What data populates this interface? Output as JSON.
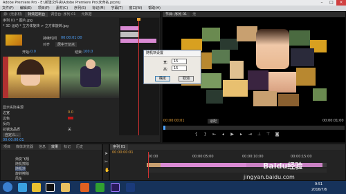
{
  "window": {
    "title": "Adobe Premiere Pro - E:\\新建文件夹\\Adobe Premiere Pro\\未命名.prproj"
  },
  "menu": [
    "文件(F)",
    "编辑(E)",
    "项目(P)",
    "素材(C)",
    "序列(S)",
    "标记(M)",
    "字幕(T)",
    "窗口(W)",
    "帮助(H)"
  ],
  "source_panel": {
    "tabs": [
      "源: (无素材)",
      "特效控制台",
      "调音台: 序列 01",
      "元数据"
    ],
    "clip_path": "序列 01 * 图片.jpg",
    "effect_path": "* 3D 运动 * 立方体旋转 > 立方体旋转.jpg",
    "section1": "持续时间",
    "duration_label": "持续时间",
    "duration_value": "00:00:01:00",
    "align_label": "对齐",
    "align_value": "居中于切点",
    "start_label": "开始:",
    "start_value": "0.0",
    "end_label": "结束:",
    "end_value": "100.0",
    "props": [
      {
        "label": "显示实际来源",
        "value": ""
      },
      {
        "label": "边宽",
        "value": "0.0"
      },
      {
        "label": "边色",
        "value": ""
      },
      {
        "label": "反向",
        "value": ""
      },
      {
        "label": "抗锯齿品质",
        "value": "关"
      },
      {
        "label": "自定义...",
        "value": ""
      }
    ],
    "timecode": "00:00:00:01"
  },
  "program_panel": {
    "tabs": [
      "节目: 序列 01",
      "无"
    ],
    "timecode": "00:00:00:01",
    "fit": "适配",
    "duration": "00:00:01:00"
  },
  "dialog": {
    "title": "随机块设置",
    "wide_label": "宽:",
    "wide_value": "15",
    "high_label": "高:",
    "high_value": "15",
    "ok": "确定",
    "cancel": "取消"
  },
  "effects_panel": {
    "tabs": [
      "项目",
      "媒体浏览器",
      "信息",
      "效果",
      "标记",
      "历史"
    ],
    "items": [
      "渐变飞翔",
      "随机擦除",
      "随机块",
      "旋转擦除",
      "风车",
      "百叶窗",
      "螺旋框"
    ]
  },
  "timeline_panel": {
    "tab": "序列 01",
    "timecode": "00:00:00:01",
    "ruler": [
      "00:00",
      "00:00:05:00",
      "00:00:10:00",
      "00:00:15:00"
    ]
  },
  "taskbar": {
    "time": "9:51",
    "date": "2016/7/6"
  },
  "watermark": {
    "logo": "Baidu经验",
    "url": "jingyan.baidu.com"
  },
  "colors": {
    "blue": "#4da3ff",
    "orange": "#e8a33a",
    "pink": "#d98ad3",
    "taskbar": "#16325a"
  }
}
